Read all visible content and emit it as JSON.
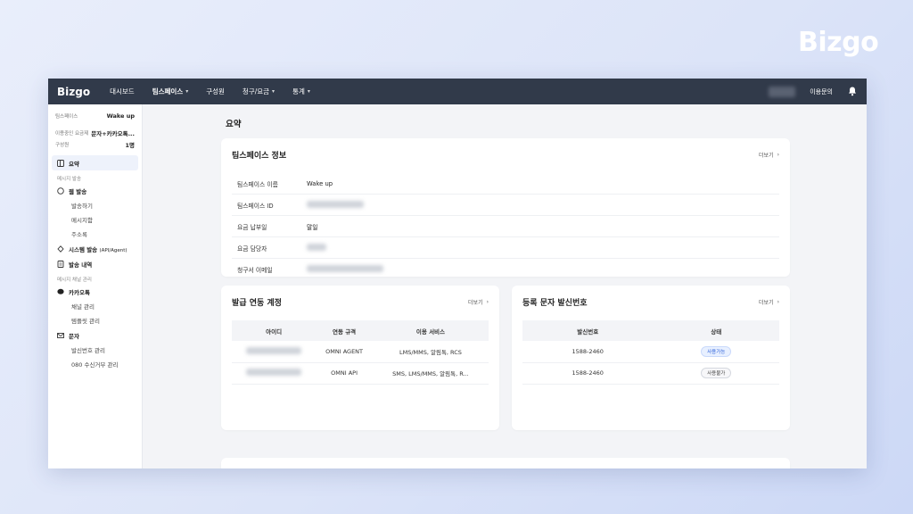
{
  "brand": {
    "wordmark": "Bizgo"
  },
  "topbar": {
    "logo": "Bizgo",
    "nav": [
      {
        "label": "대시보드",
        "dropdown": false
      },
      {
        "label": "팀스페이스",
        "dropdown": true
      },
      {
        "label": "구성원",
        "dropdown": false
      },
      {
        "label": "청구/요금",
        "dropdown": true
      },
      {
        "label": "통계",
        "dropdown": true
      }
    ],
    "help": "이용문의",
    "bell_icon": "bell-icon"
  },
  "sidebar": {
    "teamspace_key": "팀스페이스",
    "teamspace_val": "Wake up",
    "plan_key": "이용중인 요금제",
    "plan_val": "문자+카카오톡...",
    "members_key": "구성원",
    "members_val": "1명",
    "summary": "요약",
    "group_message": "메시지 발송",
    "web_send": "웹 발송",
    "web_send_sub": [
      "발송하기",
      "메시지함",
      "주소록"
    ],
    "system_send": "시스템 발송",
    "system_send_suffix": "(API/Agent)",
    "send_history": "발송 내역",
    "group_channel": "메시지 채널 관리",
    "kakao": "카카오톡",
    "kakao_sub": [
      "채널 관리",
      "템플릿 관리"
    ],
    "sms": "문자",
    "sms_sub": [
      "발신번호 관리",
      "080 수신거부 관리"
    ]
  },
  "main": {
    "title": "요약",
    "info_card": {
      "title": "팀스페이스 정보",
      "more": "더보기",
      "rows": [
        {
          "key": "팀스페이스 이름",
          "value": "Wake up"
        },
        {
          "key": "팀스페이스 ID",
          "value": ""
        },
        {
          "key": "요금 납부일",
          "value": "말일"
        },
        {
          "key": "요금 담당자",
          "value": ""
        },
        {
          "key": "청구서 이메일",
          "value": ""
        }
      ]
    },
    "account_card": {
      "title": "발급 연동 계정",
      "more": "더보기",
      "columns": [
        "아이디",
        "연동 규격",
        "이용 서비스"
      ],
      "rows": [
        {
          "id": "",
          "spec": "OMNI AGENT",
          "service": "LMS/MMS, 알림톡, RCS"
        },
        {
          "id": "",
          "spec": "OMNI API",
          "service": "SMS, LMS/MMS, 알림톡, R..."
        }
      ]
    },
    "sender_card": {
      "title": "등록 문자 발신번호",
      "more": "더보기",
      "columns": [
        "발신번호",
        "상태"
      ],
      "rows": [
        {
          "number": "1588-2460",
          "status": "사용가능",
          "ok": true
        },
        {
          "number": "1588-2460",
          "status": "사용불가",
          "ok": false
        }
      ]
    }
  },
  "colors": {
    "topbar": "#313a4a",
    "accent": "#2b5fd9",
    "background": "#f3f4f7"
  }
}
